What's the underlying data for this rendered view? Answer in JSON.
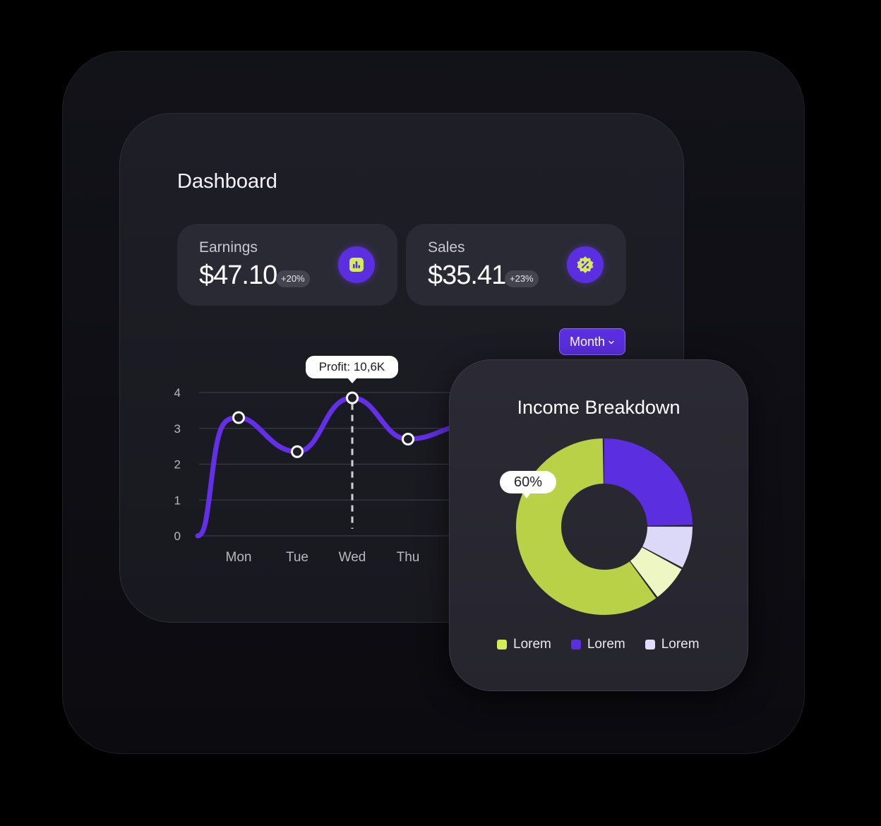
{
  "dashboard": {
    "title": "Dashboard",
    "stats": [
      {
        "label": "Earnings",
        "value": "$47.10",
        "change": "+20%",
        "icon": "bar-chart-icon"
      },
      {
        "label": "Sales",
        "value": "$35.41",
        "change": "+23%",
        "icon": "percent-badge-icon"
      }
    ],
    "period_button": "Month",
    "tooltip": "Profit: 10,6K"
  },
  "chart_data": [
    {
      "type": "line",
      "categories": [
        "Mon",
        "Tue",
        "Wed",
        "Thu"
      ],
      "y_ticks": [
        0,
        1,
        2,
        3,
        4
      ],
      "ylim": [
        0,
        4
      ],
      "points": [
        {
          "x": "Mon",
          "y": 3.3
        },
        {
          "x": "Tue",
          "y": 2.35
        },
        {
          "x": "Wed",
          "y": 3.85
        },
        {
          "x": "Thu",
          "y": 2.7
        }
      ],
      "highlight": "Wed",
      "grid": true
    },
    {
      "type": "pie",
      "title": "Income Breakdown",
      "slices": [
        {
          "label": "Lorem",
          "value": 60,
          "color": "#b9d147"
        },
        {
          "label": "Lorem",
          "value": 25,
          "color": "#5b2ee0"
        },
        {
          "value": 8,
          "color": "#dcd8f7"
        },
        {
          "value": 7,
          "color": "#eef6c3"
        }
      ],
      "highlight_label": "60%",
      "legend": [
        {
          "label": "Lorem",
          "color": "#d4ec5a"
        },
        {
          "label": "Lorem",
          "color": "#5b2ee0"
        },
        {
          "label": "Lorem",
          "color": "#e2ddff"
        }
      ]
    }
  ],
  "colors": {
    "accent": "#5b2ee0",
    "lime": "#b9d147"
  }
}
